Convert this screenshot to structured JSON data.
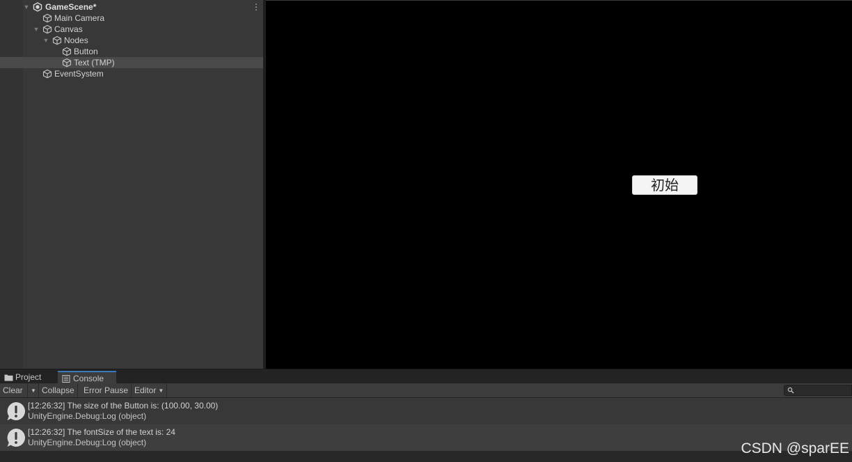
{
  "hierarchy": {
    "items": [
      {
        "label": "GameScene*",
        "icon": "unity-scene-icon"
      },
      {
        "label": "Main Camera",
        "icon": "gameobject-cube-icon"
      },
      {
        "label": "Canvas",
        "icon": "gameobject-cube-icon"
      },
      {
        "label": "Nodes",
        "icon": "gameobject-cube-icon"
      },
      {
        "label": "Button",
        "icon": "gameobject-cube-icon"
      },
      {
        "label": "Text (TMP)",
        "icon": "gameobject-cube-icon"
      },
      {
        "label": "EventSystem",
        "icon": "gameobject-cube-icon"
      }
    ],
    "selected_index": 5
  },
  "game": {
    "button_text": "初始"
  },
  "tabs": {
    "project": "Project",
    "console": "Console",
    "active": "Console"
  },
  "toolbar": {
    "clear": "Clear",
    "collapse": "Collapse",
    "error_pause": "Error Pause",
    "editor": "Editor",
    "search_placeholder": ""
  },
  "console": {
    "entries": [
      {
        "message": "[12:26:32] The size of the Button is: (100.00, 30.00)",
        "source": "UnityEngine.Debug:Log (object)",
        "icon": "info-bubble-icon"
      },
      {
        "message": "[12:26:32] The fontSize of the text is: 24",
        "source": "UnityEngine.Debug:Log (object)",
        "icon": "info-bubble-icon"
      }
    ]
  },
  "watermark": "CSDN @sparEE",
  "colors": {
    "panel_bg": "#383838",
    "selected_row": "#4a4a4a",
    "game_bg": "#000000",
    "tab_accent": "#3a79bb"
  }
}
